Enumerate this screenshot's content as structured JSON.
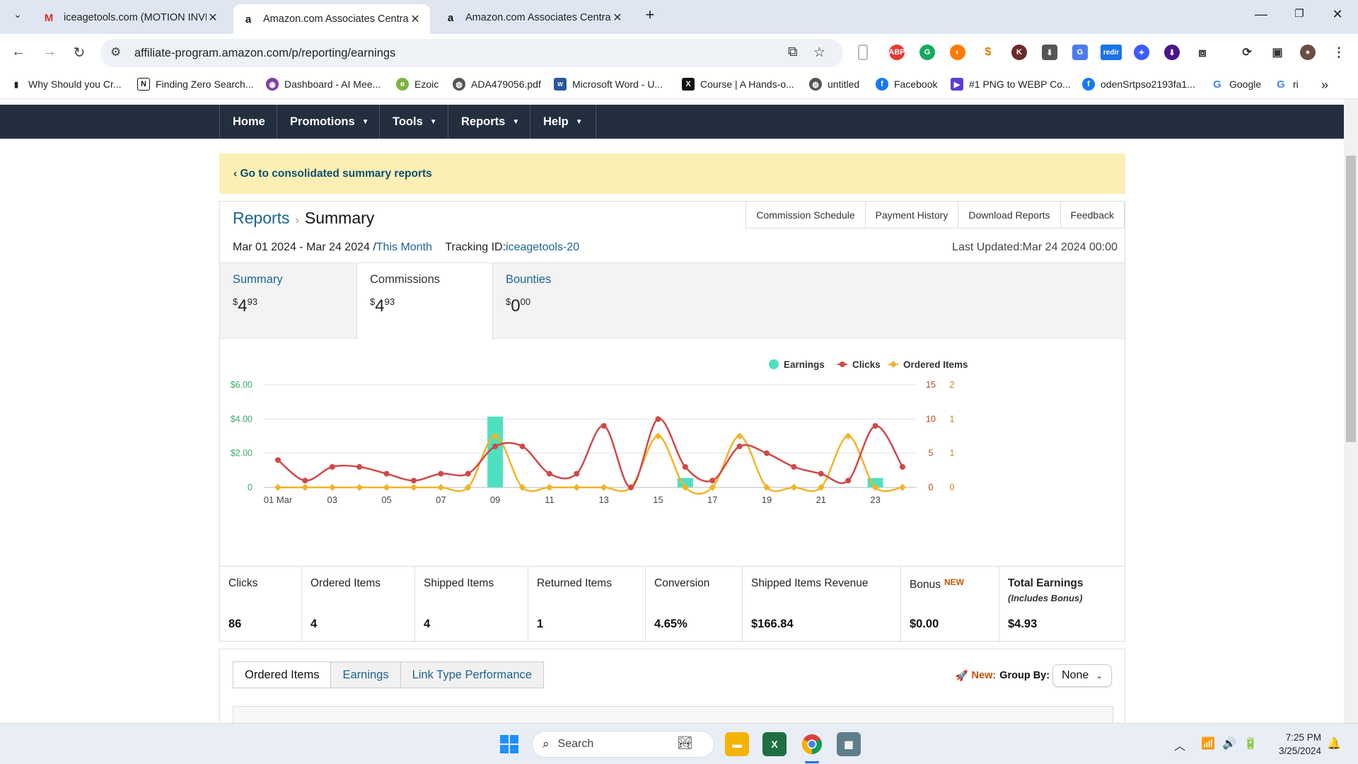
{
  "browser": {
    "tabs": [
      {
        "title": "iceagetools.com (MOTION INVE",
        "icon": "gmail-icon"
      },
      {
        "title": "Amazon.com Associates Centra",
        "icon": "amazon-icon"
      },
      {
        "title": "Amazon.com Associates Centra",
        "icon": "amazon-icon"
      }
    ],
    "url": "affiliate-program.amazon.com/p/reporting/earnings",
    "bookmarks": [
      "Why Should you Cr...",
      "Finding Zero Search...",
      "Dashboard - AI Mee...",
      "Ezoic",
      "ADA479056.pdf",
      "Microsoft Word - U...",
      "Course | A Hands-o...",
      "untitled",
      "Facebook",
      "#1 PNG to WEBP Co...",
      "odenSrtpso2193fa1...",
      "Google",
      "ri"
    ]
  },
  "nav": {
    "items": [
      "Home",
      "Promotions",
      "Tools",
      "Reports",
      "Help"
    ]
  },
  "banner": {
    "text": "‹ Go to consolidated summary reports"
  },
  "report": {
    "links": [
      "Commission Schedule",
      "Payment History",
      "Download Reports",
      "Feedback"
    ],
    "breadcrumb_root": "Reports",
    "breadcrumb_current": "Summary",
    "date_range": "Mar 01 2024 - Mar 24 2024 /",
    "range_link": "This Month",
    "tracking_label": "Tracking ID:",
    "tracking_id": "iceagetools-20",
    "last_updated": "Last Updated:Mar 24 2024 00:00",
    "summary_tabs": [
      {
        "label": "Summary",
        "cur": "$",
        "whole": "4",
        "cents": "93"
      },
      {
        "label": "Commissions",
        "cur": "$",
        "whole": "4",
        "cents": "93"
      },
      {
        "label": "Bounties",
        "cur": "$",
        "whole": "0",
        "cents": "00"
      }
    ],
    "metrics": [
      {
        "label": "Clicks",
        "value": "86"
      },
      {
        "label": "Ordered Items",
        "value": "4"
      },
      {
        "label": "Shipped Items",
        "value": "4"
      },
      {
        "label": "Returned Items",
        "value": "1"
      },
      {
        "label": "Conversion",
        "value": "4.65%"
      },
      {
        "label": "Shipped Items Revenue",
        "value": "$166.84"
      },
      {
        "label": "Bonus",
        "badge": "NEW",
        "value": "$0.00"
      },
      {
        "label": "Total Earnings",
        "sub": "(Includes Bonus)",
        "value": "$4.93"
      }
    ]
  },
  "lower": {
    "tabs": [
      "Ordered Items",
      "Earnings",
      "Link Type Performance"
    ],
    "group_new": "New:",
    "group_label": "Group By:",
    "group_value": "None"
  },
  "taskbar": {
    "search": "Search",
    "time": "7:25 PM",
    "date": "3/25/2024"
  },
  "chart_data": {
    "type": "line",
    "legend": [
      "Earnings",
      "Clicks",
      "Ordered Items"
    ],
    "colors": {
      "earnings": "#4fe0c0",
      "clicks": "#d04848",
      "ordered": "#f0b429",
      "left_axis": "#3aa86b"
    },
    "x_ticks": [
      "01 Mar",
      "03",
      "05",
      "07",
      "09",
      "11",
      "13",
      "15",
      "17",
      "19",
      "21",
      "23"
    ],
    "y_left_ticks": [
      "0",
      "$2.00",
      "$4.00",
      "$6.00"
    ],
    "y_right1_ticks": [
      "0",
      "5",
      "10",
      "15"
    ],
    "y_right2_ticks": [
      "0",
      "1",
      "1",
      "2"
    ],
    "x_days": [
      1,
      2,
      3,
      4,
      5,
      6,
      7,
      8,
      9,
      10,
      11,
      12,
      13,
      14,
      15,
      16,
      17,
      18,
      19,
      20,
      21,
      22,
      23,
      24
    ],
    "clicks": [
      4,
      1,
      3,
      3,
      2,
      1,
      2,
      2,
      6,
      6,
      2,
      2,
      9,
      0,
      10,
      3,
      1,
      6,
      5,
      3,
      2,
      1,
      9,
      3
    ],
    "ordered_items": [
      0,
      0,
      0,
      0,
      0,
      0,
      0,
      0,
      1,
      0,
      0,
      0,
      0,
      0,
      1,
      0,
      0,
      1,
      0,
      0,
      0,
      1,
      0,
      0
    ],
    "earnings": [
      0,
      0,
      0,
      0,
      0,
      0,
      0,
      0,
      4.14,
      0,
      0,
      0,
      0,
      0,
      0,
      0.55,
      0,
      0,
      0,
      0,
      0,
      0,
      0.55,
      0
    ],
    "ylim_left": [
      0,
      6
    ],
    "ylim_clicks": [
      0,
      15
    ],
    "ylim_ordered": [
      0,
      2
    ]
  }
}
